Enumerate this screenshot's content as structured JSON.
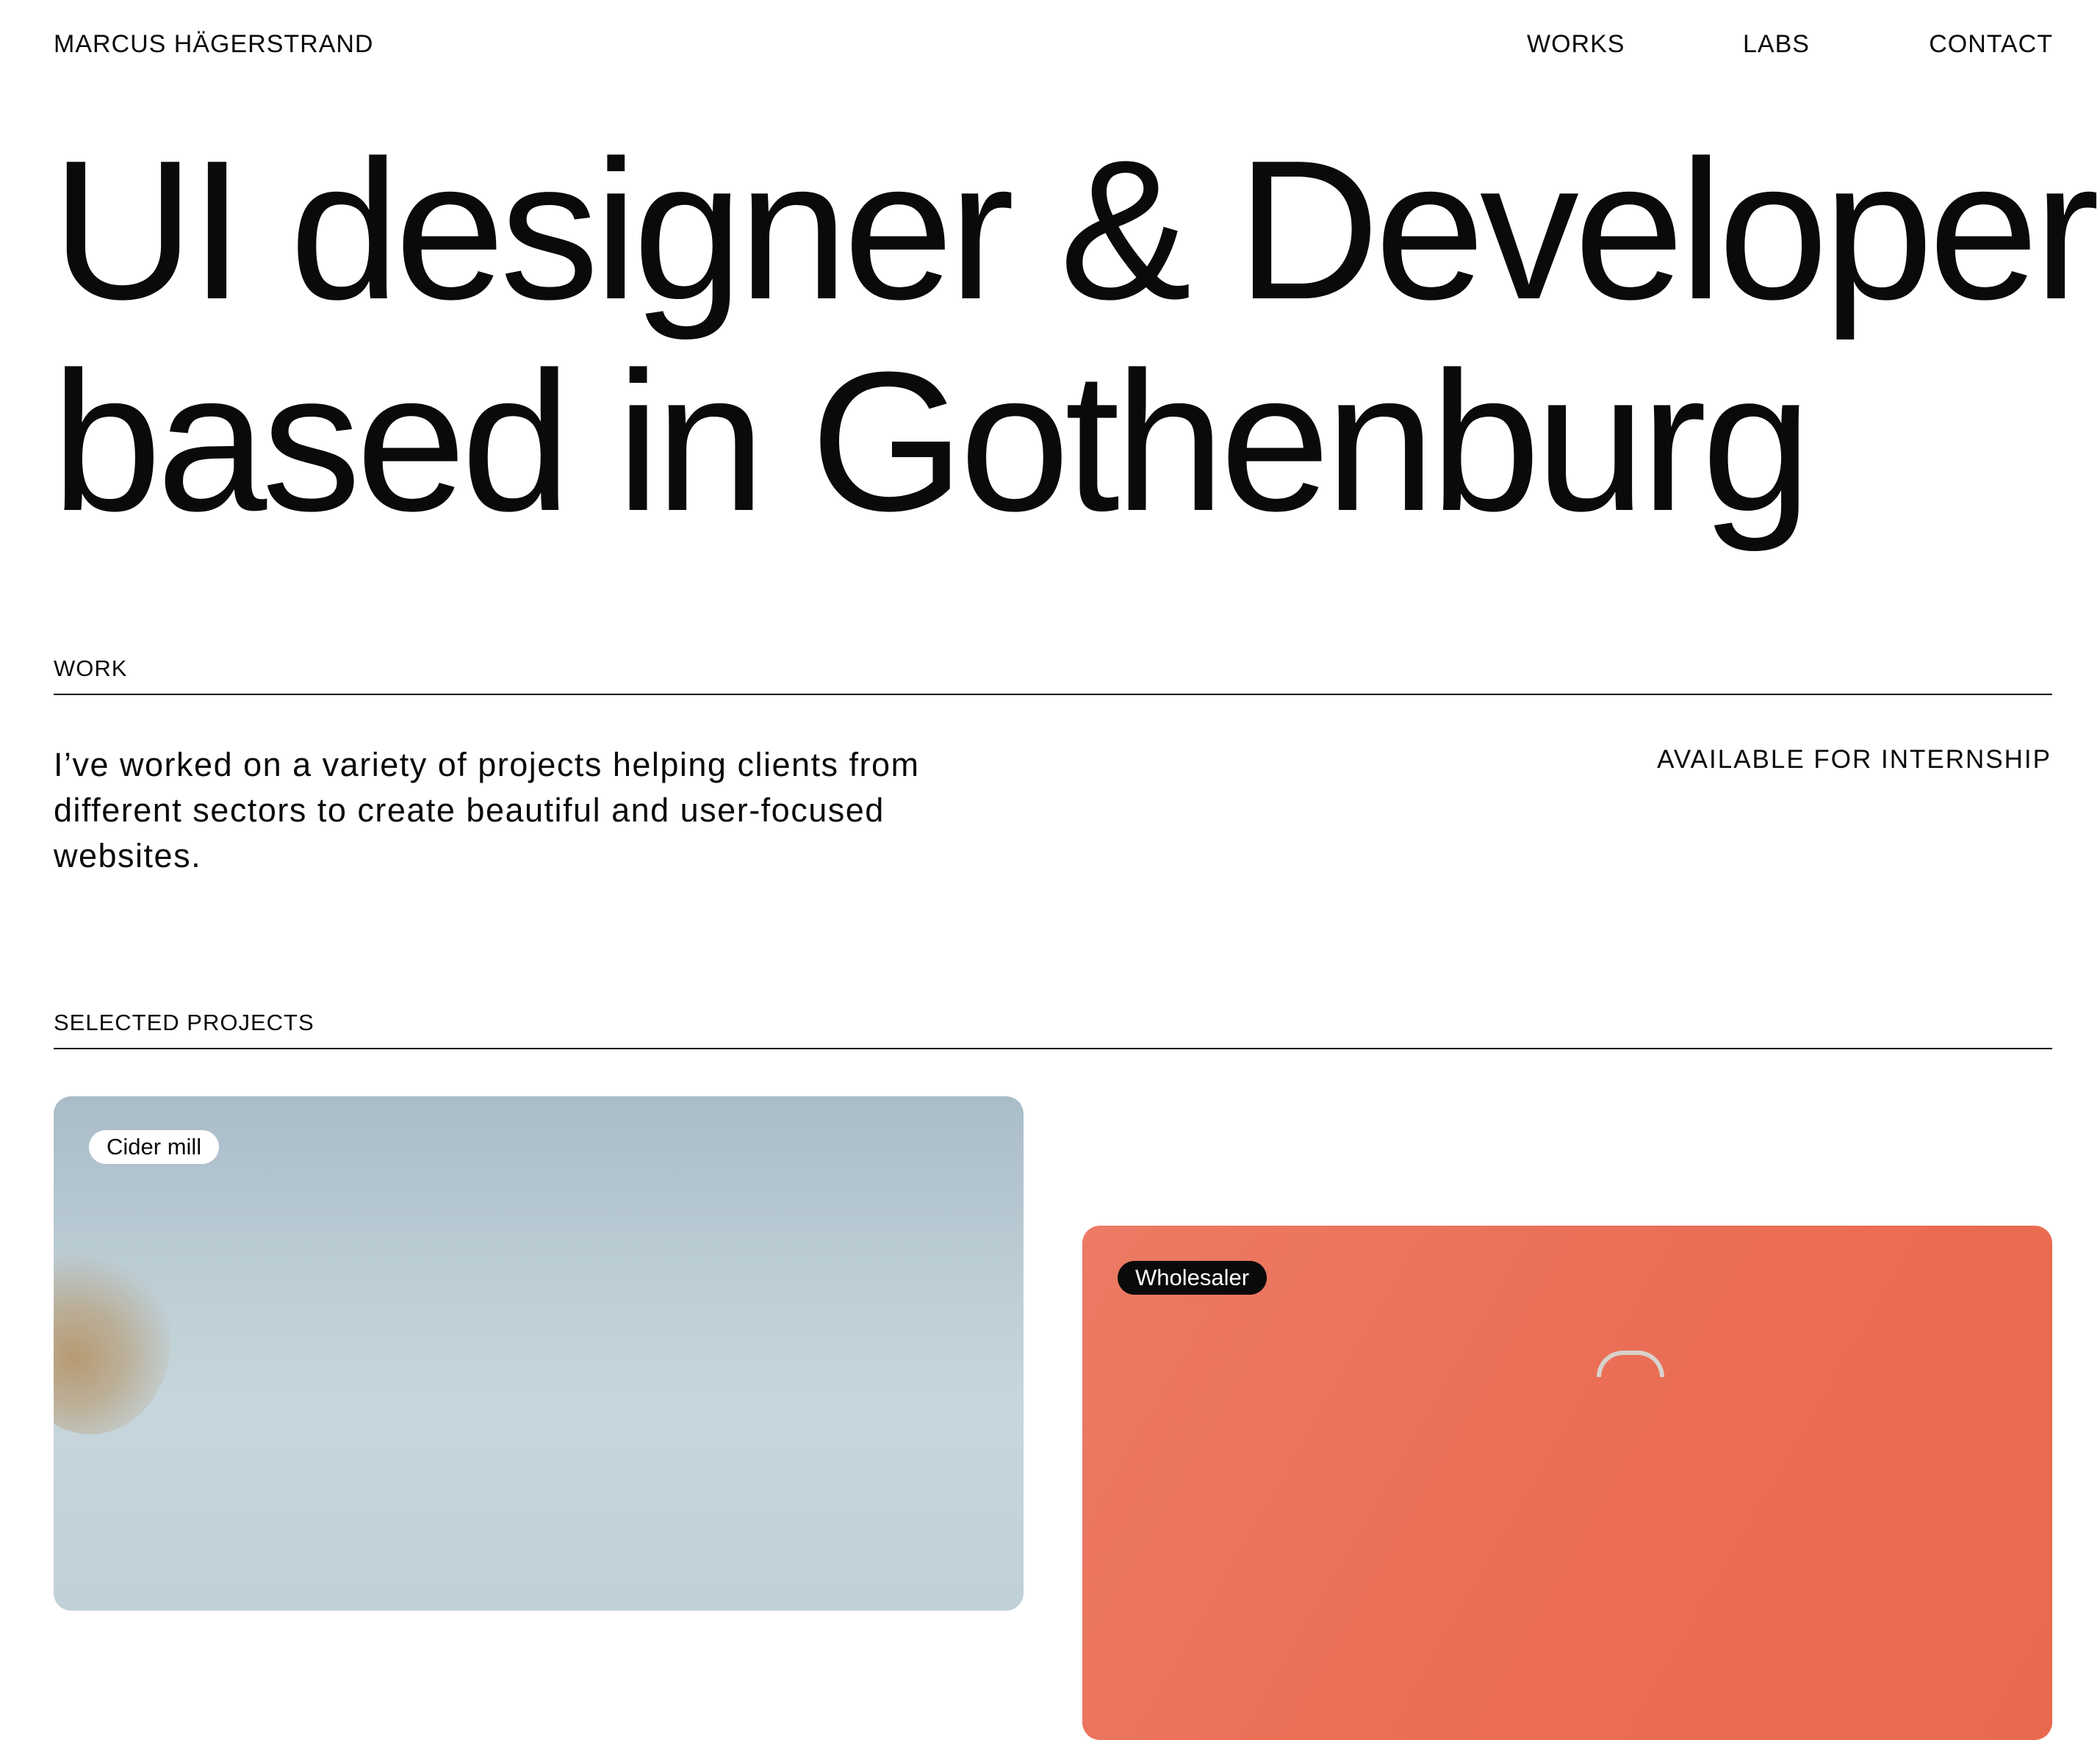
{
  "header": {
    "brand": "MARCUS HÄGERSTRAND",
    "nav": [
      {
        "label": "WORKS"
      },
      {
        "label": "LABS"
      },
      {
        "label": "CONTACT"
      }
    ]
  },
  "hero": {
    "line1": "UI designer & Developer",
    "line2": "based in Gothenburg"
  },
  "work": {
    "label": "WORK",
    "intro": "I’ve worked on a variety of projects helping clients from different sectors to create beautiful and user-focused websites.",
    "availability": "AVAILABLE FOR INTERNSHIP"
  },
  "projects": {
    "label": "SELECTED PROJECTS",
    "items": [
      {
        "tag": "Cider mill",
        "color": "#b4c7d1"
      },
      {
        "tag": "Wholesaler",
        "color": "#ea6d54"
      }
    ]
  },
  "colors": {
    "text": "#0a0a0a",
    "background": "#ffffff",
    "accent_coral": "#ea6d54",
    "accent_sky": "#b4c7d1"
  }
}
